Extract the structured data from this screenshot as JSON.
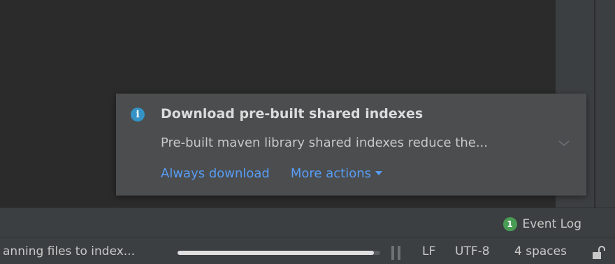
{
  "notification": {
    "icon": "info-icon",
    "icon_glyph": "i",
    "title": "Download pre-built shared indexes",
    "body": "Pre-built maven library shared indexes reduce the...",
    "actions": {
      "always_download": "Always download",
      "more_actions": "More actions"
    }
  },
  "toolstrip": {
    "event_log_count": "1",
    "event_log_label": "Event Log"
  },
  "statusbar": {
    "task_text": "anning files to index...",
    "progress": 0.97,
    "line_separator": "LF",
    "encoding": "UTF-8",
    "indent": "4 spaces"
  },
  "colors": {
    "accent_link": "#589df6",
    "info_icon": "#3592c4",
    "badge": "#499c54"
  }
}
